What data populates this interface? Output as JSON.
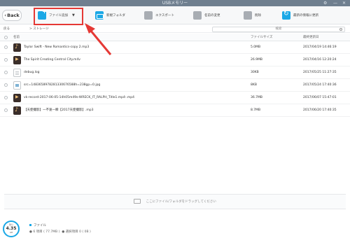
{
  "window": {
    "title": "USBメモリー",
    "controls": "⚙  —  ×"
  },
  "toolbar": {
    "back_label": "Back",
    "items": [
      {
        "label": "ファイル追加",
        "icon": "add-file-icon"
      },
      {
        "label": "新規フォルダ",
        "icon": "new-folder-icon"
      },
      {
        "label": "エクスポート",
        "icon": "export-icon"
      },
      {
        "label": "名前の変更",
        "icon": "rename-icon"
      },
      {
        "label": "削除",
        "icon": "delete-icon"
      },
      {
        "label": "最新の情報に更新",
        "icon": "refresh-icon"
      }
    ],
    "colors": {
      "accent": "#1aa8e6",
      "highlight": "#e53935"
    }
  },
  "addressbar": {
    "back_label": "戻る",
    "breadcrumb": "> ストレージ",
    "search_placeholder": "検索"
  },
  "table": {
    "headers": {
      "name": "名前",
      "size": "ファイルサイズ",
      "date": "最終更新日"
    },
    "rows": [
      {
        "name": "Taylor Swift - New Romantics-copy 2.mp3",
        "size": "5.0MB",
        "date": "2017/04/19 14:46:19",
        "icon": "music-icon"
      },
      {
        "name": "The Spirit Creating Central City.m4v",
        "size": "26.9MB",
        "date": "2017/04/16 12:20:24",
        "icon": "video-icon"
      },
      {
        "name": "debug.log",
        "size": "30KB",
        "date": "2017/05/25 11:27:35",
        "icon": "document-icon"
      },
      {
        "name": "src=1483658978281330676588h=238gp=0.jpg",
        "size": "8KB",
        "date": "2017/05/24 17:40:36",
        "icon": "image-icon"
      },
      {
        "name": "vk-record-2017-06-05-14h05m49s-WRECK_IT_RALPH_Title1.mp4-.mp4",
        "size": "36.7MB",
        "date": "2017/06/07 15:47:01",
        "icon": "video-icon"
      },
      {
        "name": "【天使撮影】一不速一瞬【2017天使撮影】.mp3",
        "size": "8.7MB",
        "date": "2017/06/20 17:40:35",
        "icon": "music-icon"
      }
    ]
  },
  "dropzone": {
    "text": "ここにファイル/フォルダをドラッグしてください"
  },
  "footer": {
    "storage_label": "残り",
    "storage_value": "4.35",
    "storage_unit": "GB",
    "legend_label": "ファイル",
    "files_count": "6 項目 ( 77.7MB )",
    "selected": "選択項目 0 ( 0B )"
  }
}
